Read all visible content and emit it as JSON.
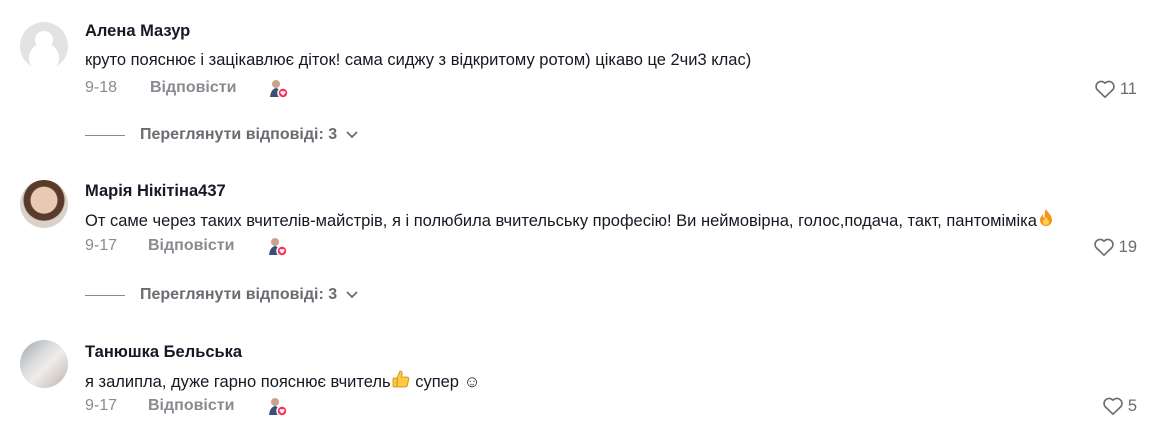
{
  "comments": [
    {
      "author": "Алена Мазур",
      "text": "круто пояснює і зацікавлює діток! сама сиджу з відкритому ротом) цікаво це 2чи3 клас)",
      "emoji": "",
      "date": "9-18",
      "reply_label": "Відповісти",
      "likes": "11",
      "view_replies": "Переглянути відповіді: 3"
    },
    {
      "author": "Марія Нікітіна437",
      "text": "От саме через таких вчителів-майстрів, я і полюбила вчительську професію! Ви неймовірна, голос,подача, такт, пантоміміка",
      "emoji": "fire",
      "date": "9-17",
      "reply_label": "Відповісти",
      "likes": "19",
      "view_replies": "Переглянути відповіді: 3"
    },
    {
      "author": "Танюшка Бельська",
      "text_before": "я залипла, дуже гарно пояснює вчитель",
      "text_after": " супер ☺",
      "emoji": "thumbs-up",
      "date": "9-17",
      "reply_label": "Відповісти",
      "likes": "5"
    }
  ],
  "colors": {
    "text": "#161823",
    "muted": "#8a8b91",
    "like_badge": "#fe2c55"
  }
}
